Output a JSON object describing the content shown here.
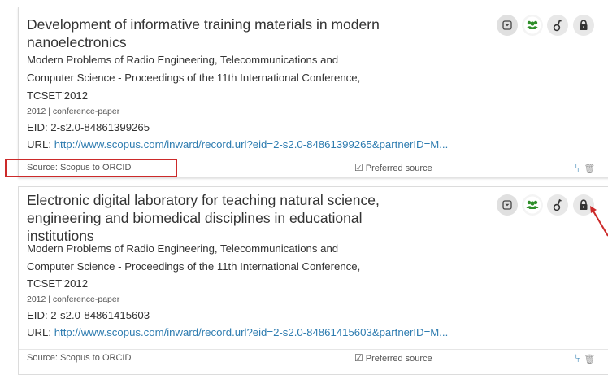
{
  "records": [
    {
      "title": "Development of informative training materials in modern nanoelectronics",
      "journal_lines": [
        "Modern Problems of Radio Engineering, Telecommunications and",
        "Computer Science - Proceedings of the 11th International Conference,",
        "TCSET'2012"
      ],
      "meta": "2012 | conference-paper",
      "eid": "EID: 2-s2.0-84861399265",
      "url_label": "URL: ",
      "url": "http://www.scopus.com/inward/record.url?eid=2-s2.0-84861399265&partnerID=M...",
      "source": "Source: Scopus to ORCID",
      "preferred": "Preferred source"
    },
    {
      "title": "Electronic digital laboratory for teaching natural science, engineering and biomedical disciplines in educational institutions",
      "journal_lines": [
        "Modern Problems of Radio Engineering, Telecommunications and",
        "Computer Science - Proceedings of the 11th International Conference,",
        "TCSET'2012"
      ],
      "meta": "2012 | conference-paper",
      "eid": "EID: 2-s2.0-84861415603",
      "url_label": "URL: ",
      "url": "http://www.scopus.com/inward/record.url?eid=2-s2.0-84861415603&partnerID=M...",
      "source": "Source: Scopus to ORCID",
      "preferred": "Preferred source"
    }
  ],
  "icons": {
    "expand": "expand-toggle-icon",
    "visibility_everyone": "everyone-visibility-icon",
    "visibility_trusted": "trusted-visibility-icon",
    "visibility_private": "private-lock-icon",
    "preferred_check": "checkbox-check-icon",
    "combine": "branch-icon",
    "delete": "trash-icon"
  },
  "colors": {
    "link": "#2e7cb0",
    "everyone_active": "#2f8f2a",
    "annotation_red": "#cc2a2a"
  }
}
